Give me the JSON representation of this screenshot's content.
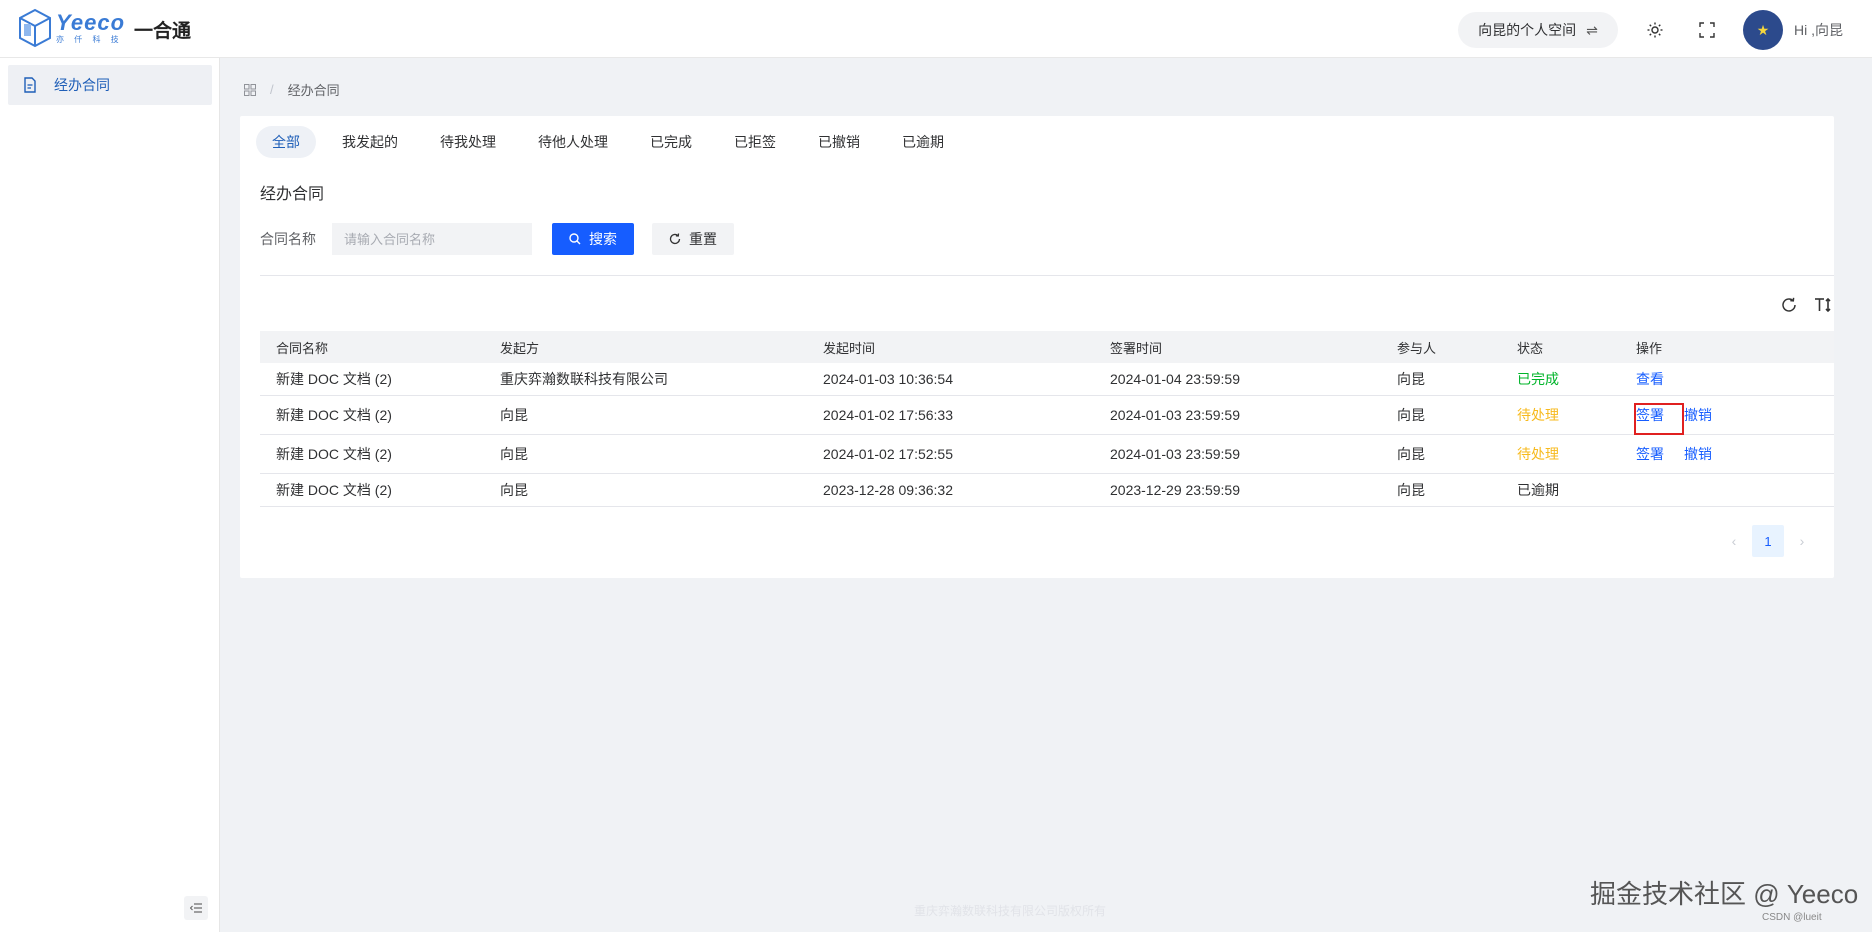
{
  "header": {
    "logo_word": "Yeeco",
    "logo_sub": "亦 仟 科 技",
    "app_title": "一合通",
    "space_label": "向昆的个人空间",
    "greeting": "Hi ,向昆"
  },
  "sidebar": {
    "items": [
      {
        "label": "经办合同",
        "icon": "document-icon"
      }
    ]
  },
  "breadcrumb": {
    "current": "经办合同"
  },
  "tabs": [
    {
      "label": "全部",
      "active": true
    },
    {
      "label": "我发起的"
    },
    {
      "label": "待我处理"
    },
    {
      "label": "待他人处理"
    },
    {
      "label": "已完成"
    },
    {
      "label": "已拒签"
    },
    {
      "label": "已撤销"
    },
    {
      "label": "已逾期"
    }
  ],
  "section_title": "经办合同",
  "search": {
    "label": "合同名称",
    "placeholder": "请输入合同名称",
    "search_button": "搜索",
    "reset_button": "重置"
  },
  "table": {
    "columns": [
      "合同名称",
      "发起方",
      "发起时间",
      "签署时间",
      "参与人",
      "状态",
      "操作"
    ],
    "rows": [
      {
        "name": "新建 DOC 文档 (2)",
        "initiator": "重庆弈瀚数联科技有限公司",
        "start": "2024-01-03 10:36:54",
        "sign": "2024-01-04 23:59:59",
        "participant": "向昆",
        "status": "已完成",
        "actions": [
          "查看"
        ]
      },
      {
        "name": "新建 DOC 文档 (2)",
        "initiator": "向昆",
        "start": "2024-01-02 17:56:33",
        "sign": "2024-01-03 23:59:59",
        "participant": "向昆",
        "status": "待处理",
        "actions": [
          "签署",
          "撤销"
        ]
      },
      {
        "name": "新建 DOC 文档 (2)",
        "initiator": "向昆",
        "start": "2024-01-02 17:52:55",
        "sign": "2024-01-03 23:59:59",
        "participant": "向昆",
        "status": "待处理",
        "actions": [
          "签署",
          "撤销"
        ]
      },
      {
        "name": "新建 DOC 文档 (2)",
        "initiator": "向昆",
        "start": "2023-12-28 09:36:32",
        "sign": "2023-12-29 23:59:59",
        "participant": "向昆",
        "status": "已逾期",
        "actions": []
      }
    ]
  },
  "pagination": {
    "current": "1"
  },
  "footer": {
    "faint_text": "重庆弈瀚数联科技有限公司版权所有",
    "watermark": "掘金技术社区 @ Yeeco",
    "csdn": "CSDN @lueit"
  },
  "colors": {
    "primary": "#165dff",
    "done": "#00b42a",
    "pending": "#f7ba1e",
    "highlight": "#e02020"
  }
}
